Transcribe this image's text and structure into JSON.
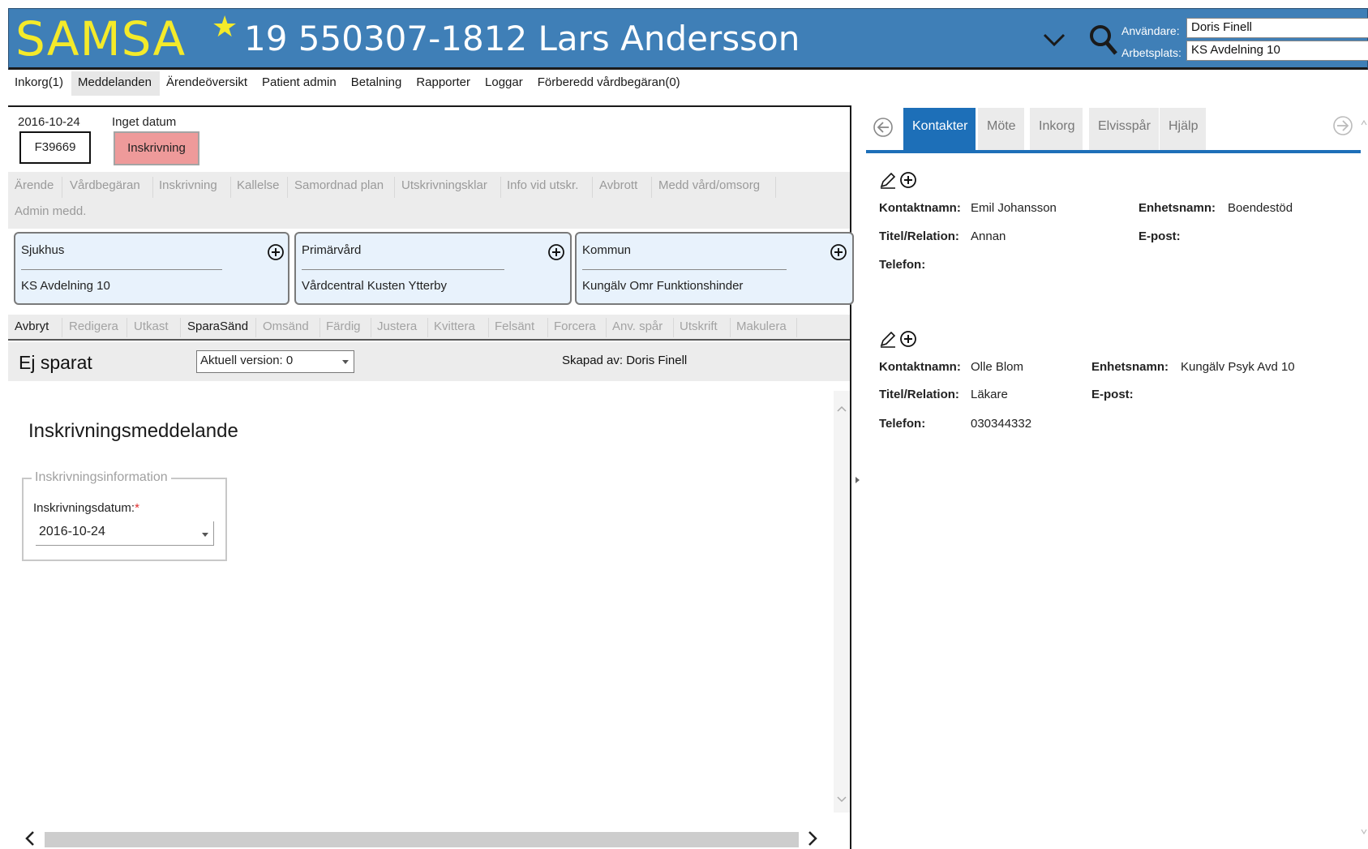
{
  "header": {
    "logo": "SAMSA",
    "patient_title": "19 550307-1812 Lars  Andersson",
    "user_label": "Användare:",
    "user_value": "Doris Finell",
    "workplace_label": "Arbetsplats:",
    "workplace_value": "KS Avdelning 10",
    "brand_color": "#3f7fb7",
    "logo_color": "#f4ea2a"
  },
  "main_menu": [
    {
      "label": "Inkorg(1)"
    },
    {
      "label": "Meddelanden"
    },
    {
      "label": "Ärendeöversikt"
    },
    {
      "label": "Patient admin"
    },
    {
      "label": "Betalning"
    },
    {
      "label": "Rapporter"
    },
    {
      "label": "Loggar"
    },
    {
      "label": "Förberedd vårdbegäran(0)"
    }
  ],
  "case": {
    "date": "2016-10-24",
    "no_date": "Inget datum",
    "id": "F39669",
    "status": "Inskrivning"
  },
  "case_tabs": [
    "Ärende",
    "Vårdbegäran",
    "Inskrivning",
    "Kallelse",
    "Samordnad plan",
    "Utskrivningsklar",
    "Info vid utskr.",
    "Avbrott",
    "Medd vård/omsorg",
    "Admin medd."
  ],
  "cards": [
    {
      "title": "Sjukhus",
      "value": "KS Avdelning 10"
    },
    {
      "title": "Primärvård",
      "value": "Vårdcentral Kusten Ytterby"
    },
    {
      "title": "Kommun",
      "value": "Kungälv Omr Funktionshinder"
    }
  ],
  "actions": [
    {
      "label": "Avbryt",
      "enabled": true
    },
    {
      "label": "Redigera",
      "enabled": false
    },
    {
      "label": "Utkast",
      "enabled": false
    },
    {
      "label": "SparaSänd",
      "enabled": true
    },
    {
      "label": "Omsänd",
      "enabled": false
    },
    {
      "label": "Färdig",
      "enabled": false
    },
    {
      "label": "Justera",
      "enabled": false
    },
    {
      "label": "Kvittera",
      "enabled": false
    },
    {
      "label": "Felsänt",
      "enabled": false
    },
    {
      "label": "Forcera",
      "enabled": false
    },
    {
      "label": "Anv. spår",
      "enabled": false
    },
    {
      "label": "Utskrift",
      "enabled": false
    },
    {
      "label": "Makulera",
      "enabled": false
    }
  ],
  "save": {
    "status": "Ej sparat",
    "version_selected": "Aktuell version: 0",
    "created_by": "Skapad av: Doris Finell"
  },
  "form": {
    "title": "Inskrivningsmeddelande",
    "legend": "Inskrivningsinformation",
    "date_label": "Inskrivningsdatum:",
    "required_mark": "*",
    "date_value": "2016-10-24"
  },
  "right_tabs": [
    {
      "label": "Kontakter",
      "active": true
    },
    {
      "label": "Möte",
      "active": false
    },
    {
      "label": "Inkorg",
      "active": false
    },
    {
      "label": "Elvisspår",
      "active": false
    },
    {
      "label": "Hjälp",
      "active": false
    }
  ],
  "contacts": [
    {
      "name_label": "Kontaktnamn:",
      "name": "Emil Johansson",
      "unit_label": "Enhetsnamn:",
      "unit": "Boendestöd",
      "title_label": "Titel/Relation:",
      "title": "Annan",
      "email_label": "E-post:",
      "email": "",
      "phone_label": "Telefon:",
      "phone": ""
    },
    {
      "name_label": "Kontaktnamn:",
      "name": "Olle Blom",
      "unit_label": "Enhetsnamn:",
      "unit": "Kungälv Psyk Avd 10",
      "title_label": "Titel/Relation:",
      "title": "Läkare",
      "email_label": "E-post:",
      "email": "",
      "phone_label": "Telefon:",
      "phone": "030344332"
    }
  ]
}
